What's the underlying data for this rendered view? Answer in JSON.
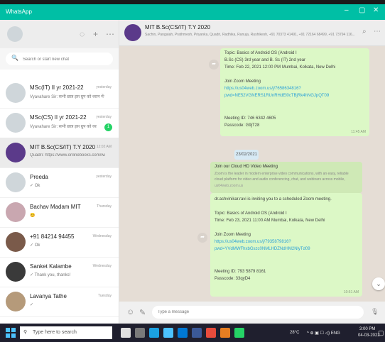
{
  "window": {
    "title": "WhatsApp",
    "controls": [
      "–",
      "▢",
      "✕"
    ]
  },
  "sidebar": {
    "header_icons": {
      "status": "◌",
      "new_chat": "+",
      "menu": "⋯"
    },
    "search": {
      "icon": "🔍",
      "placeholder": "Search or start new chat"
    },
    "chats": [
      {
        "name": "MSc(IT) II yr 2021-22",
        "time": "yesterday",
        "snippet": "Vyavahare Sir: सभी छात्र इस ग्रुप को ध्यान में रखें..."
      },
      {
        "name": "MSc(CS) II yr 2021-22",
        "time": "yesterday",
        "snippet": "Vyavahare Sir: सभी छात्र इस ग्रुप को ध्यान में रखें...",
        "badge": "1"
      },
      {
        "name": "MIT B.Sc(CS/IT) T.Y 2020",
        "time": "12:02 AM",
        "snippet": "Quadri: https://www.onlinebooks.com/watch?v..."
      },
      {
        "name": "Preeda",
        "time": "yesterday",
        "snippet": "✓ Ok"
      },
      {
        "name": "Bachav Madam MIT",
        "time": "Thursday",
        "snippet": "😊"
      },
      {
        "name": "+91 84214 94455",
        "time": "Wednesday",
        "snippet": "✓ Ok"
      },
      {
        "name": "Sanket Kalambe",
        "time": "Wednesday",
        "snippet": "✓ Thank you, thanks!"
      },
      {
        "name": "Lavanya Tathe",
        "time": "Tuesday",
        "snippet": "✓"
      }
    ]
  },
  "conversation": {
    "title": "MIT B.Sc(CS/IT) T.Y 2020",
    "members": "Sachin, Pangaiah, Prathmesh, Priyanka, Quadri, Radhika, Ranuja, Rushikesh, +91 70373 41491, +91 72164 68499, +91 73794 116...",
    "header_icons": {
      "search": "⌕",
      "menu": "⋯"
    },
    "date_chip": "23/02/2021",
    "bubble1": {
      "lines": [
        "Topic: Basics of Android OS (Android I",
        "B.Sc (CS) 3rd year and B. Sc (IT) 2nd year",
        "Time: Feb 22, 2021 12:00 PM Mumbai, Kolkata, New Delhi",
        "",
        "Join Zoom Meeting",
        "https://us04web.zoom.us/j/7658634816?",
        "pwd=NE52VGNERS1RUnRHdEl0cTBjRk4hNGJpQT09",
        "",
        "Meeting ID: 746 6342 4605",
        "Passcode: G9jT28"
      ],
      "time": "11:45 AM"
    },
    "bubble2": {
      "lines": [
        "Join our Cloud HD Video Meeting",
        "Zoom is the leader in modern enterprise video communications, with an easy, reliable",
        "cloud platform for video and audio conferencing, chat, and webinars across mobile,",
        "us04web.zoom.us"
      ]
    },
    "bubble3": {
      "lines": [
        "dr.ashvinikar.ravi is inviting you to a scheduled Zoom meeting.",
        "",
        "Topic: Basics of Android OS (Android I",
        "Time: Feb 23, 2021 11:00 AM Mumbai, Kolkata, New Delhi",
        "",
        "Join Zoom Meeting",
        "https://us04web.zoom.us/j/7935879816?",
        "pwd=YVdMWFhxbGszc0NMLHDZNdHM2NlyTd09",
        "",
        "Meeting ID: 793 5879 8161",
        "Passcode: 33qyD4"
      ],
      "time": "10:51 AM"
    },
    "forward_icon": "➦",
    "scroll_down_icon": "⌄",
    "composer": {
      "emoji_icon": "☺",
      "attach_icon": "✎",
      "placeholder": "Type a message",
      "mic_icon": "🎙"
    }
  },
  "taskbar": {
    "search_icon": "⚲",
    "search_placeholder": "Type here to search",
    "weather": "28°C",
    "tray_icons": "^ ⊕ ▣ ☐ ◁) ENG",
    "time": "3:00 PM",
    "date": "04-03-2022"
  }
}
